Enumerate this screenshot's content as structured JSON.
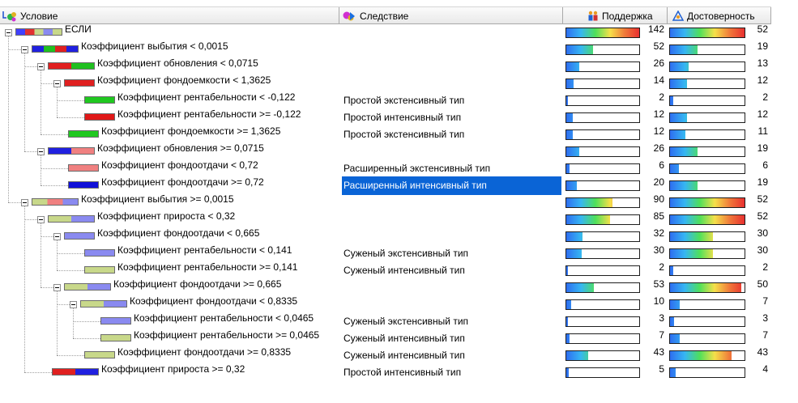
{
  "header": {
    "condition_label": "Условие",
    "consequence_label": "Следствие",
    "support_label": "Поддержка",
    "confidence_label": "Достоверность"
  },
  "colors": {
    "selection": "#0a64d6",
    "tree_lines": "#a0a0a0",
    "gradient": [
      "#2e6ef0",
      "#36b6f2",
      "#4fe05a",
      "#f5e04a",
      "#f07a3a",
      "#e83030"
    ]
  },
  "rows": [
    {
      "depth": 0,
      "expander": true,
      "bar": [
        "#4040ff",
        "#e23030",
        "#c8d88a",
        "#8a8af0",
        "#c8d88a"
      ],
      "text": "ЕСЛИ",
      "consequence": "",
      "support": 142,
      "confidence": 52
    },
    {
      "depth": 1,
      "expander": true,
      "bar": [
        "#2020e0",
        "#20c020",
        "#e02020",
        "#2020e0"
      ],
      "text": "Коэффициент выбытия  < 0,0015",
      "consequence": "",
      "support": 52,
      "confidence": 19
    },
    {
      "depth": 2,
      "expander": true,
      "bar": [
        "#e02020",
        "#20c020"
      ],
      "text": "Коэффициент обновления < 0,0715",
      "consequence": "",
      "support": 26,
      "confidence": 13
    },
    {
      "depth": 3,
      "expander": true,
      "bar": [
        "#e02020"
      ],
      "text": "Коэффициент фондоемкости  < 1,3625",
      "consequence": "",
      "support": 14,
      "confidence": 12
    },
    {
      "depth": 4,
      "expander": false,
      "bar": [
        "#20c820"
      ],
      "text": "Коэффициент рентабельности  < -0,122",
      "consequence": "Простой экстенсивный тип",
      "support": 2,
      "confidence": 2
    },
    {
      "depth": 4,
      "expander": false,
      "bar": [
        "#e01818"
      ],
      "text": "Коэффициент рентабельности  >= -0,122",
      "consequence": "Простой интенсивный тип",
      "support": 12,
      "confidence": 12
    },
    {
      "depth": 3,
      "expander": false,
      "bar": [
        "#20c820"
      ],
      "text": "Коэффициент фондоемкости >= 1,3625",
      "consequence": "Простой экстенсивный тип",
      "support": 12,
      "confidence": 11
    },
    {
      "depth": 2,
      "expander": true,
      "bar": [
        "#2020e0",
        "#f08080"
      ],
      "text": "Коэффициент обновления >= 0,0715",
      "consequence": "",
      "support": 26,
      "confidence": 19
    },
    {
      "depth": 3,
      "expander": false,
      "bar": [
        "#f08080"
      ],
      "text": "Коэффициент фондоотдачи < 0,72",
      "consequence": "Расширенный экстенсивный тип",
      "support": 6,
      "confidence": 6
    },
    {
      "depth": 3,
      "expander": false,
      "bar": [
        "#1010d8"
      ],
      "text": "Коэффициент фондоотдачи >= 0,72",
      "consequence": "Расширенный интенсивный тип",
      "support": 20,
      "confidence": 19,
      "selected": true
    },
    {
      "depth": 1,
      "expander": true,
      "bar": [
        "#c8d88a",
        "#f08080",
        "#8a8af0"
      ],
      "text": "Коэффициент выбытия  >= 0,0015",
      "consequence": "",
      "support": 90,
      "confidence": 52
    },
    {
      "depth": 2,
      "expander": true,
      "bar": [
        "#c8d88a",
        "#8a8af0"
      ],
      "text": "Коэффициент прироста < 0,32",
      "consequence": "",
      "support": 85,
      "confidence": 52
    },
    {
      "depth": 3,
      "expander": true,
      "bar": [
        "#8a8af0"
      ],
      "text": "Коэффициент фондоотдачи < 0,665",
      "consequence": "",
      "support": 32,
      "confidence": 30
    },
    {
      "depth": 4,
      "expander": false,
      "bar": [
        "#8a8af0"
      ],
      "text": "Коэффициент рентабельности  < 0,141",
      "consequence": "Суженый экстенсивный тип",
      "support": 30,
      "confidence": 30
    },
    {
      "depth": 4,
      "expander": false,
      "bar": [
        "#c8d88a"
      ],
      "text": "Коэффициент рентабельности  >= 0,141",
      "consequence": "Суженый интенсивный тип",
      "support": 2,
      "confidence": 2
    },
    {
      "depth": 3,
      "expander": true,
      "bar": [
        "#c8d88a",
        "#8a8af0"
      ],
      "text": "Коэффициент фондоотдачи >= 0,665",
      "consequence": "",
      "support": 53,
      "confidence": 50
    },
    {
      "depth": 4,
      "expander": true,
      "bar": [
        "#c8d88a",
        "#8a8af0"
      ],
      "text": "Коэффициент фондоотдачи < 0,8335",
      "consequence": "",
      "support": 10,
      "confidence": 7
    },
    {
      "depth": 5,
      "expander": false,
      "bar": [
        "#8a8af0"
      ],
      "text": "Коэффициент рентабельности  < 0,0465",
      "consequence": "Суженый экстенсивный тип",
      "support": 3,
      "confidence": 3
    },
    {
      "depth": 5,
      "expander": false,
      "bar": [
        "#c8d88a"
      ],
      "text": "Коэффициент рентабельности  >= 0,0465",
      "consequence": "Суженый интенсивный тип",
      "support": 7,
      "confidence": 7
    },
    {
      "depth": 4,
      "expander": false,
      "bar": [
        "#c8d88a"
      ],
      "text": "Коэффициент фондоотдачи >= 0,8335",
      "consequence": "Суженый интенсивный тип",
      "support": 43,
      "confidence": 43
    },
    {
      "depth": 2,
      "expander": false,
      "bar": [
        "#e02020",
        "#2020e0"
      ],
      "text": "Коэффициент прироста >= 0,32",
      "consequence": "Простой интенсивный тип",
      "support": 5,
      "confidence": 4
    }
  ]
}
